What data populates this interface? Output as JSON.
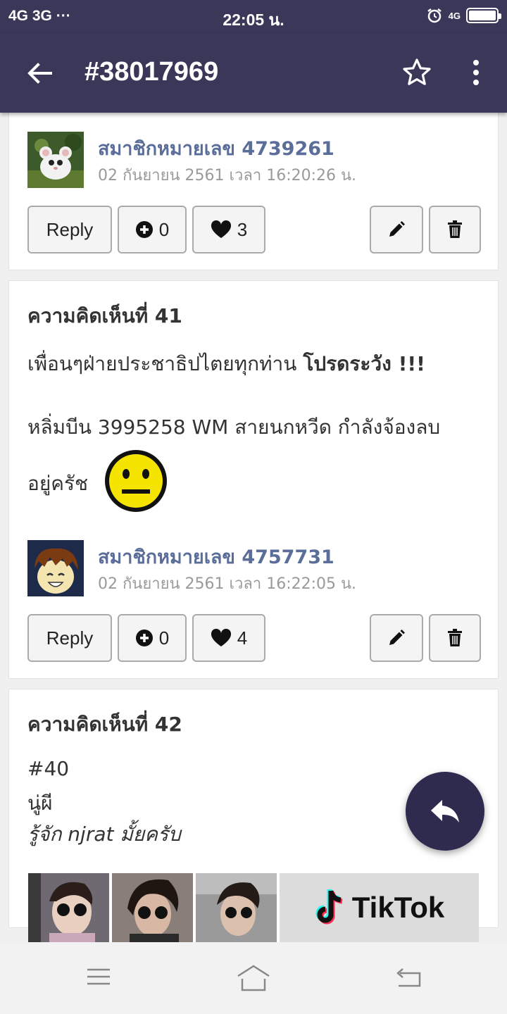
{
  "status_bar": {
    "network": "4G 3G ···",
    "time": "22:05 น.",
    "mobile_data": "4G"
  },
  "app_bar": {
    "title": "#38017969",
    "icons": [
      "back-arrow-icon",
      "star-icon",
      "more-vert-icon"
    ]
  },
  "comments": [
    {
      "author": "สมาชิกหมายเลข 4739261",
      "date": "02 กันยายน 2561 เวลา 16:20:26 น.",
      "reply_label": "Reply",
      "plus_count": "0",
      "like_count": "3"
    },
    {
      "heading": "ความคิดเห็นที่ 41",
      "line1_normal": "เพื่อนๆฝ่ายประชาธิปไตยทุกท่าน",
      "line1_bold": "โปรดระวัง !!!",
      "line2": "หลิ่มบีน 3995258 WM สายนกหวีด กำลังจ้องลบ",
      "line3": "อยู่ครัช",
      "emoji": "neutral-face-emoji",
      "author": "สมาชิกหมายเลข 4757731",
      "date": "02 กันยายน 2561 เวลา 16:22:05 น.",
      "reply_label": "Reply",
      "plus_count": "0",
      "like_count": "4"
    },
    {
      "heading": "ความคิดเห็นที่ 42",
      "line1": "#40",
      "line2": "นู่ผี",
      "line3": "รู้จัก njrat มั้ยครับ"
    }
  ],
  "ad_banner": {
    "brand": "TikTok"
  },
  "colors": {
    "app_bar": "#3a3759",
    "author_link": "#5b6e9a",
    "fab": "#2e2b4f"
  }
}
